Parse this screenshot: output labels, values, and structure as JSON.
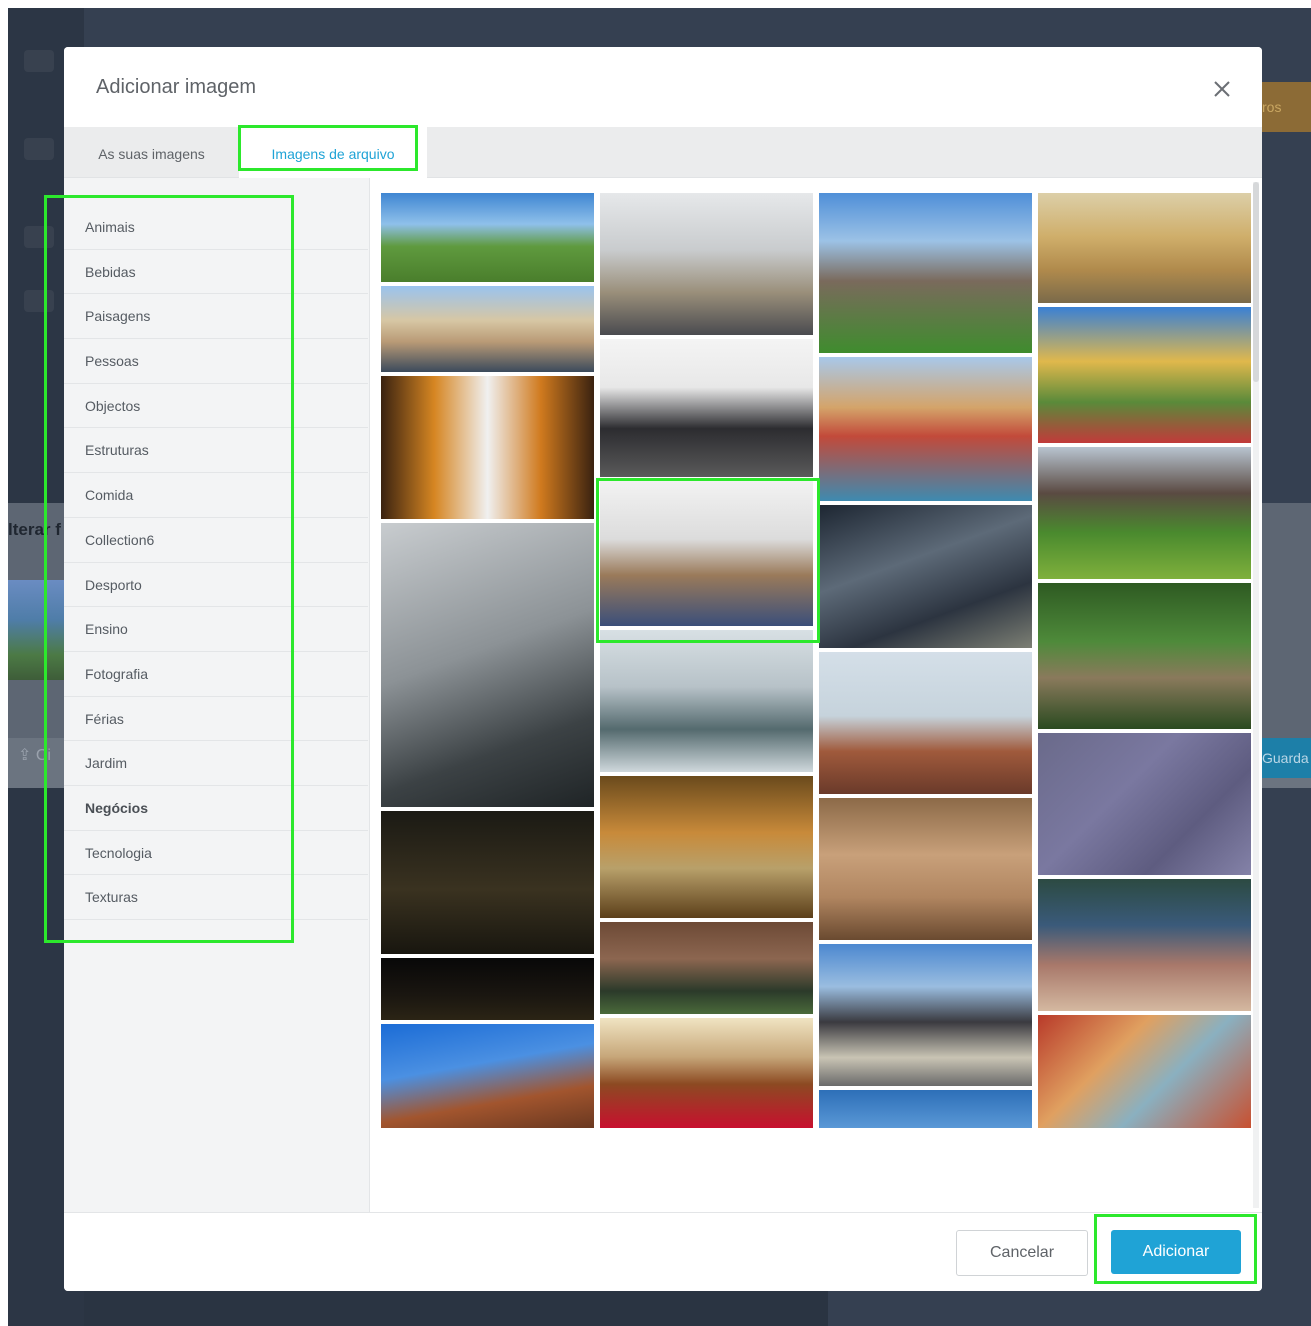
{
  "modal": {
    "title": "Adicionar imagem",
    "tabs": [
      {
        "label": "As suas imagens"
      },
      {
        "label": "Imagens de arquivo"
      }
    ],
    "categories": [
      "Animais",
      "Bebidas",
      "Paisagens",
      "Pessoas",
      "Objectos",
      "Estruturas",
      "Comida",
      "Collection6",
      "Desporto",
      "Ensino",
      "Fotografia",
      "Férias",
      "Jardim",
      "Negócios",
      "Tecnologia",
      "Texturas"
    ],
    "active_category": "Negócios",
    "footer": {
      "cancel_label": "Cancelar",
      "add_label": "Adicionar"
    }
  },
  "background": {
    "panel_title": "lterar f",
    "upload_label": "Ci",
    "save_label": "Guarda",
    "orange_label": "ros"
  },
  "colors": {
    "accent": "#1fa3d6",
    "highlight": "#2ce82c",
    "backdrop": "#354051"
  }
}
